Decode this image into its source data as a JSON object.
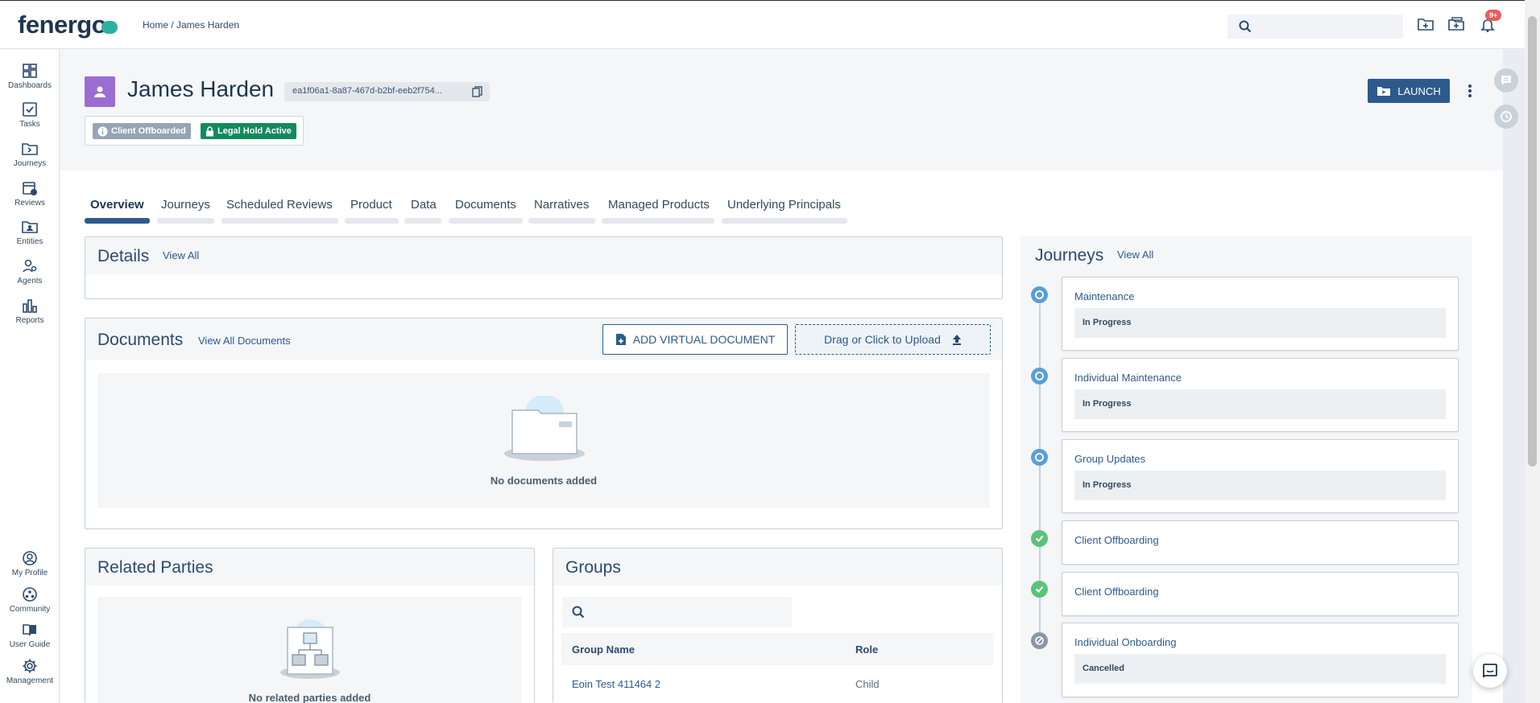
{
  "app": {
    "logo_text": "fenergo",
    "breadcrumb": "Home / James Harden",
    "notification_count": "9+"
  },
  "sidenav": {
    "top_items": [
      {
        "label": "Dashboards",
        "icon": "dashboard-icon"
      },
      {
        "label": "Tasks",
        "icon": "tasks-icon"
      },
      {
        "label": "Journeys",
        "icon": "journeys-icon"
      },
      {
        "label": "Reviews",
        "icon": "reviews-icon"
      },
      {
        "label": "Entities",
        "icon": "entities-icon"
      },
      {
        "label": "Agents",
        "icon": "agents-icon"
      },
      {
        "label": "Reports",
        "icon": "reports-icon"
      }
    ],
    "bottom_items": [
      {
        "label": "My Profile",
        "icon": "profile-icon"
      },
      {
        "label": "Community",
        "icon": "community-icon"
      },
      {
        "label": "User Guide",
        "icon": "book-icon"
      },
      {
        "label": "Management",
        "icon": "gear-icon"
      }
    ]
  },
  "entity": {
    "name": "James Harden",
    "id": "ea1f06a1-8a87-467d-b2bf-eeb2f754...",
    "badges": [
      {
        "label": "Client Offboarded",
        "color": "#95a5b5"
      },
      {
        "label": "Legal Hold Active",
        "color": "#138a5e"
      }
    ],
    "launch_label": "LAUNCH"
  },
  "tabs": [
    "Overview",
    "Journeys",
    "Scheduled Reviews",
    "Product",
    "Data",
    "Documents",
    "Narratives",
    "Managed Products",
    "Underlying Principals"
  ],
  "details": {
    "title": "Details",
    "view_all": "View All"
  },
  "documents": {
    "title": "Documents",
    "view_all": "View All Documents",
    "add_virtual": "ADD VIRTUAL DOCUMENT",
    "upload": "Drag or Click to Upload",
    "empty_text": "No documents added"
  },
  "related_parties": {
    "title": "Related Parties",
    "empty_text": "No related parties added"
  },
  "groups": {
    "title": "Groups",
    "columns": [
      "Group Name",
      "Role"
    ],
    "rows": [
      {
        "name": "Eoin Test 411464 2",
        "role": "Child"
      }
    ]
  },
  "journeys": {
    "title": "Journeys",
    "view_all": "View All",
    "items": [
      {
        "name": "Maintenance",
        "status": "In Progress",
        "state": "in-progress"
      },
      {
        "name": "Individual Maintenance",
        "status": "In Progress",
        "state": "in-progress"
      },
      {
        "name": "Group Updates",
        "status": "In Progress",
        "state": "in-progress"
      },
      {
        "name": "Client Offboarding",
        "status": "",
        "state": "complete"
      },
      {
        "name": "Client Offboarding",
        "status": "",
        "state": "complete"
      },
      {
        "name": "Individual Onboarding",
        "status": "Cancelled",
        "state": "cancelled"
      }
    ]
  },
  "colors": {
    "primary": "#2d5a8c",
    "success": "#5cc27a",
    "progress": "#5a9fd6",
    "cancelled": "#8a97a5"
  }
}
